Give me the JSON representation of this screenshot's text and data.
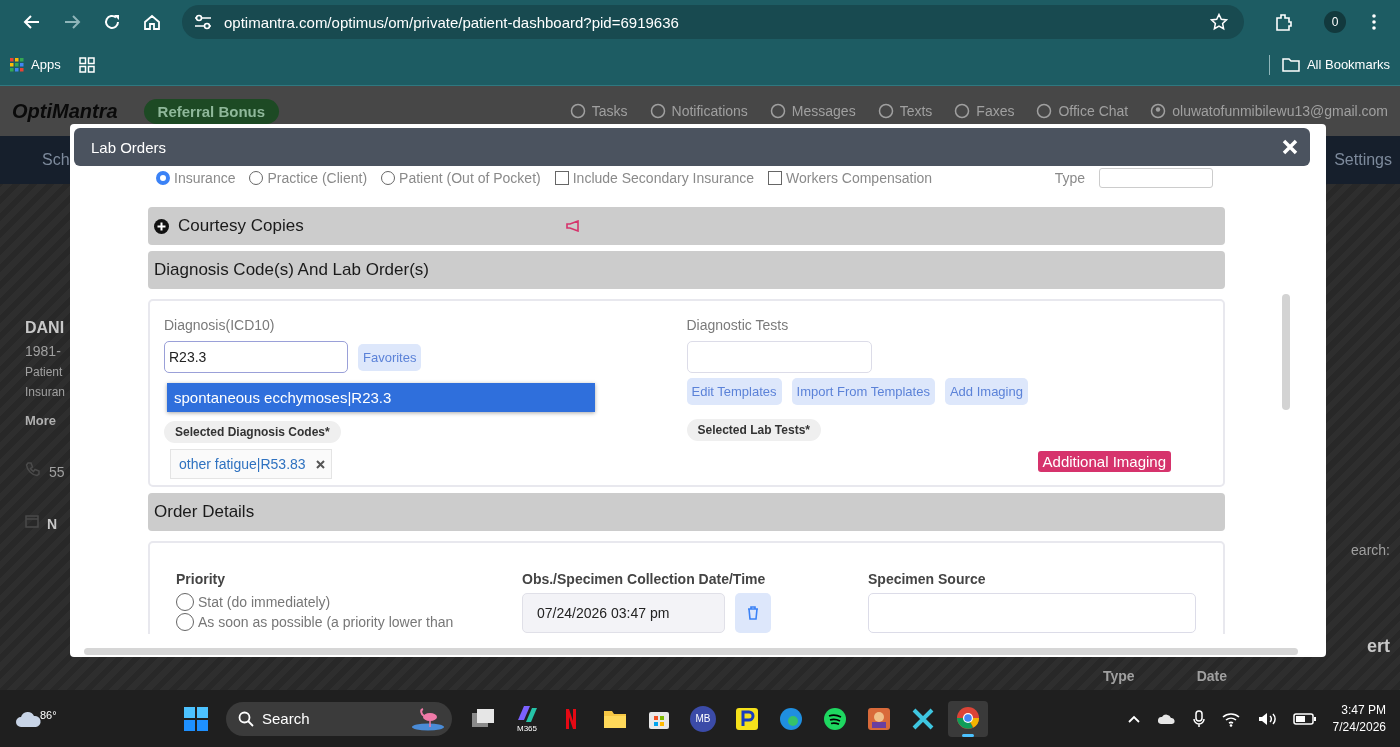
{
  "browser": {
    "url": "optimantra.com/optimus/om/private/patient-dashboard?pid=6919636",
    "profile": "0",
    "apps_label": "Apps",
    "all_bookmarks": "All Bookmarks"
  },
  "app": {
    "logo": "OptiMantra",
    "referral": "Referral Bonus",
    "nav": [
      "Tasks",
      "Notifications",
      "Messages",
      "Texts",
      "Faxes",
      "Office Chat"
    ],
    "email": "oluwatofunmibilewu13@gmail.com",
    "menu_left": "Sch",
    "menu_right": "Settings",
    "patient": {
      "name": "DANI",
      "dob": "1981-",
      "line_1": "Patient",
      "line_2": "Insuran",
      "more": "More",
      "phone": "55",
      "note": "N"
    },
    "right_texts": {
      "search": "earch:",
      "col_1": "Type",
      "col_2": "Date",
      "alert": "ert"
    }
  },
  "modal": {
    "title": "Lab Orders",
    "payer_options": [
      {
        "kind": "radio",
        "label": "Insurance",
        "checked": true
      },
      {
        "kind": "radio",
        "label": "Practice (Client)",
        "checked": false
      },
      {
        "kind": "radio",
        "label": "Patient (Out of Pocket)",
        "checked": false
      },
      {
        "kind": "checkbox",
        "label": "Include Secondary Insurance",
        "checked": false
      },
      {
        "kind": "checkbox",
        "label": "Workers Compensation",
        "checked": false
      }
    ],
    "type_label": "Type",
    "courtesy": {
      "title": "Courtesy Copies",
      "expanded": false
    },
    "diagnosis_header": "Diagnosis Code(s) And Lab Order(s)",
    "diagnosis": {
      "label": "Diagnosis(ICD10)",
      "value": "R23.3",
      "favorites": "Favorites",
      "suggestions": [
        {
          "label": "spontaneous ecchymoses|R23.3",
          "selected": true
        }
      ],
      "selected_label": "Selected Diagnosis Codes*",
      "codes": [
        {
          "label": "other fatigue|R53.83"
        }
      ]
    },
    "tests": {
      "label": "Diagnostic Tests",
      "buttons": [
        "Edit Templates",
        "Import From Templates",
        "Add Imaging"
      ],
      "selected_label": "Selected Lab Tests*",
      "badge": "Additional Imaging"
    },
    "order_header": "Order Details",
    "order": {
      "priority_label": "Priority",
      "priorities": [
        {
          "label": "Stat (do immediately)",
          "selected": false
        },
        {
          "label": "As soon as possible (a priority lower than",
          "selected": false
        }
      ],
      "date_label": "Obs./Specimen Collection Date/Time",
      "date_value": "07/24/2026 03:47 pm",
      "source_label": "Specimen Source"
    }
  },
  "taskbar": {
    "temperature": "86°",
    "search": "Search",
    "copilot_label": "M365",
    "mb_label": "MB",
    "time": "3:47 PM",
    "date": "7/24/2026"
  }
}
